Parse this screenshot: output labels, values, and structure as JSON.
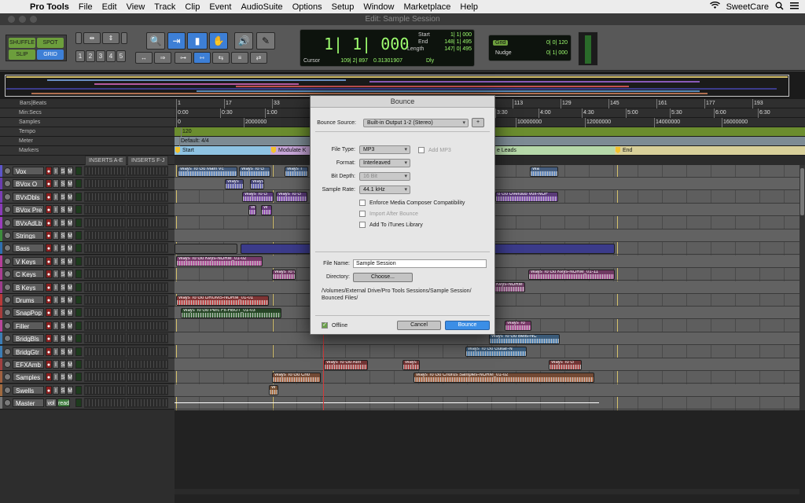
{
  "menubar": {
    "app": "Pro Tools",
    "items": [
      "File",
      "Edit",
      "View",
      "Track",
      "Clip",
      "Event",
      "AudioSuite",
      "Options",
      "Setup",
      "Window",
      "Marketplace",
      "Help"
    ],
    "user": "SweetCare"
  },
  "window": {
    "title": "Edit: Sample Session"
  },
  "modes": {
    "shuffle": "SHUFFLE",
    "spot": "SPOT",
    "slip": "SLIP",
    "grid": "GRID"
  },
  "zoom": {
    "presets": [
      "1",
      "2",
      "3",
      "4",
      "5"
    ]
  },
  "counter": {
    "main": "1| 1| 000",
    "start_label": "Start",
    "start": "1| 1| 000",
    "end_label": "End",
    "end": "148| 1| 495",
    "length_label": "Length",
    "length": "147| 0| 495",
    "cursor_label": "Cursor",
    "cursor": "109| 2| 897",
    "sample": "0.31301907",
    "dly": "Dly"
  },
  "grid_nudge": {
    "grid_label": "Grid",
    "grid_value": "0| 0| 120",
    "nudge_label": "Nudge",
    "nudge_value": "0| 1| 000"
  },
  "rulers": {
    "bars_label": "Bars|Beats",
    "minsecs_label": "Min:Secs",
    "samples_label": "Samples",
    "tempo_label": "Tempo",
    "meter_label": "Meter",
    "markers_label": "Markers",
    "bars_ticks": [
      "1",
      "17",
      "33",
      "113",
      "129",
      "145",
      "161",
      "177",
      "193"
    ],
    "min_ticks": [
      "0:00",
      "0:30",
      "1:00",
      "3:30",
      "4:00",
      "4:30",
      "5:00",
      "5:30",
      "6:00",
      "6:30"
    ],
    "sample_ticks": [
      "0",
      "2000000",
      "10000000",
      "12000000",
      "14000000",
      "16000000"
    ],
    "tempo": "120",
    "meter": "Default: 4/4",
    "markers": [
      "Start",
      "Modulate K",
      "e Leads",
      "End"
    ]
  },
  "inserts": {
    "a": "INSERTS A-E",
    "b": "INSERTS F-J"
  },
  "tracks": [
    {
      "name": "Vox",
      "color": "#5c55c9"
    },
    {
      "name": "BVox O",
      "color": "#6a3db0"
    },
    {
      "name": "BVxDbls",
      "color": "#7a3db4"
    },
    {
      "name": "BVox Pre",
      "color": "#8a3bb8"
    },
    {
      "name": "BVxAdLb",
      "color": "#9a3dbc"
    },
    {
      "name": "Strings",
      "color": "#3c8c3c"
    },
    {
      "name": "Bass",
      "color": "#2f6fb0"
    },
    {
      "name": "V Keys",
      "color": "#b53e9a"
    },
    {
      "name": "C Keys",
      "color": "#a93d92"
    },
    {
      "name": "B Keys",
      "color": "#9c3c8a"
    },
    {
      "name": "Drums",
      "color": "#b83a3a"
    },
    {
      "name": "SnapPop",
      "color": "#a63d3d"
    },
    {
      "name": "Filler",
      "color": "#b8469a"
    },
    {
      "name": "BridgBls",
      "color": "#3c7db5"
    },
    {
      "name": "BridgGtr",
      "color": "#3c7db5"
    },
    {
      "name": "EFXAmb",
      "color": "#a04040"
    },
    {
      "name": "Samples",
      "color": "#a06040"
    },
    {
      "name": "Swells",
      "color": "#a06a40"
    },
    {
      "name": "Master",
      "color": "#777777"
    }
  ],
  "master": {
    "vol": "vol",
    "read": "read"
  },
  "clips": [
    {
      "lane": 0,
      "label": "Ways To Go Main Vc",
      "color": "#6a8fc2"
    },
    {
      "lane": 0,
      "label": "Ways To G",
      "color": "#6a8fc2"
    },
    {
      "lane": 0,
      "label": "Ways T",
      "color": "#6a8fc2"
    },
    {
      "lane": 0,
      "label": "Wa",
      "color": "#6a8fc2"
    },
    {
      "lane": 1,
      "label": "Ways",
      "color": "#6a6ab8"
    },
    {
      "lane": 1,
      "label": "Ways",
      "color": "#6a6ab8"
    },
    {
      "lane": 2,
      "label": "Ways To G",
      "color": "#8a5ab8"
    },
    {
      "lane": 2,
      "label": "Ways To G",
      "color": "#8a5ab8"
    },
    {
      "lane": 2,
      "label": "o Go Overdub Vox-NOF",
      "color": "#8a5ab8"
    },
    {
      "lane": 3,
      "label": "W",
      "color": "#9a5ab8"
    },
    {
      "lane": 3,
      "label": "W",
      "color": "#9a5ab8"
    },
    {
      "lane": 7,
      "label": "Ways To Go Keys-NORM_01-02",
      "color": "#b55aa0"
    },
    {
      "lane": 8,
      "label": "Ways To G",
      "color": "#a95a96"
    },
    {
      "lane": 8,
      "label": "Ways To Go Keys-NORM_01-11",
      "color": "#a95a96"
    },
    {
      "lane": 9,
      "label": "Keys-NORM",
      "color": "#9c5a8e"
    },
    {
      "lane": 10,
      "label": "Ways To Go DRUMS-NORM_01-01",
      "color": "#c25050"
    },
    {
      "lane": 11,
      "label": "Ways To Go Perc Fx-HBUT_01-03",
      "color": "#3c6a3c"
    },
    {
      "lane": 12,
      "label": "Ways To",
      "color": "#b85aa0"
    },
    {
      "lane": 13,
      "label": "Ways To Go Bells-NC",
      "color": "#5a8ab8"
    },
    {
      "lane": 14,
      "label": "Ways To Go Guitar-N",
      "color": "#5a8ab8"
    },
    {
      "lane": 15,
      "label": "Ways To Go Atm",
      "color": "#b05050"
    },
    {
      "lane": 15,
      "label": "Ways To G",
      "color": "#b05050"
    },
    {
      "lane": 15,
      "label": "Ways To G",
      "color": "#b05050"
    },
    {
      "lane": 16,
      "label": "Ways To Go Cho",
      "color": "#b07050"
    },
    {
      "lane": 16,
      "label": "Ways To Go Chorus Samples-NORM_01-02",
      "color": "#b07050"
    },
    {
      "lane": 17,
      "label": "W",
      "color": "#b07a50"
    }
  ],
  "bounce": {
    "title": "Bounce",
    "source_label": "Bounce Source:",
    "source_value": "Built-in Output 1-2 (Stereo)",
    "add_button": "+",
    "file_type_label": "File Type:",
    "file_type": "MP3",
    "add_mp3": "Add MP3",
    "format_label": "Format:",
    "format": "Interleaved",
    "bit_depth_label": "Bit Depth:",
    "bit_depth": "16 Bit",
    "sample_rate_label": "Sample Rate:",
    "sample_rate": "44.1 kHz",
    "enforce": "Enforce Media Composer Compatibility",
    "import_after": "Import After Bounce",
    "add_itunes": "Add To iTunes Library",
    "file_name_label": "File Name:",
    "file_name": "Sample Session",
    "directory_label": "Directory:",
    "choose_button": "Choose...",
    "path": "/Volumes/External Drive/Pro Tools Sessions/Sample Session/ Bounced Files/",
    "offline": "Offline",
    "cancel": "Cancel",
    "bounce": "Bounce"
  },
  "colors": {
    "accent": "#3b8ee6",
    "counter_text": "#9eff6f",
    "marker": "#f3c22b",
    "playhead": "#d23a3a"
  }
}
